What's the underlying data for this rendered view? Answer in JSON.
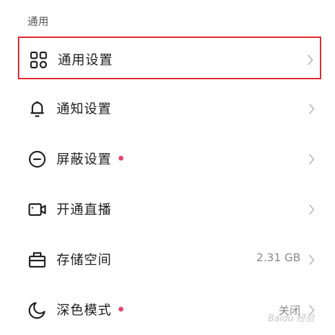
{
  "section": {
    "title": "通用"
  },
  "colors": {
    "highlight": "#e0262b",
    "dot": "#e8456a",
    "text": "#1e1e1e",
    "muted": "#8a8a8a"
  },
  "settings": [
    {
      "label": "通用设置",
      "icon": "grid-icon",
      "value": "",
      "dot": false,
      "highlighted": true
    },
    {
      "label": "通知设置",
      "icon": "bell-icon",
      "value": "",
      "dot": false,
      "highlighted": false
    },
    {
      "label": "屏蔽设置",
      "icon": "block-circle-icon",
      "value": "",
      "dot": true,
      "highlighted": false
    },
    {
      "label": "开通直播",
      "icon": "video-camera-icon",
      "value": "",
      "dot": false,
      "highlighted": false
    },
    {
      "label": "存储空间",
      "icon": "storage-icon",
      "value": "2.31 GB",
      "dot": false,
      "highlighted": false
    },
    {
      "label": "深色模式",
      "icon": "moon-icon",
      "value": "关闭",
      "dot": true,
      "highlighted": false
    }
  ],
  "watermark": "Baidu 经验"
}
